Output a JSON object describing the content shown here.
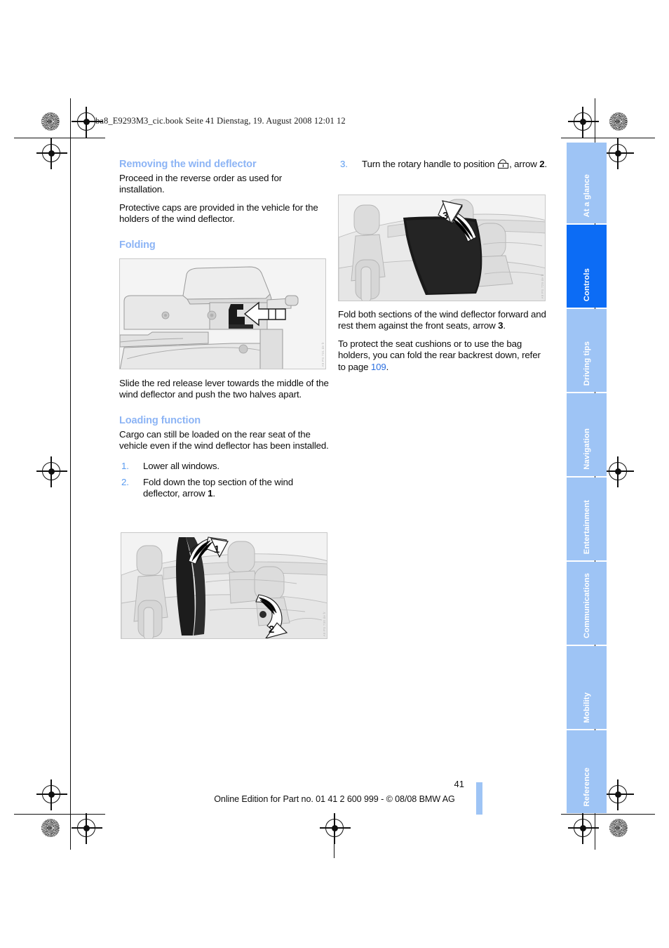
{
  "scan_header": "ba8_E9293M3_cic.book  Seite 41  Dienstag, 19. August 2008  12:01 12",
  "left_column": {
    "heading_1": "Removing the wind deflector",
    "para_1": "Proceed in the reverse order as used for installation.",
    "para_2": "Protective caps are provided in the vehicle for the holders of the wind deflector.",
    "heading_2": "Folding",
    "figure_1_code": "A9 PS 731 de fr",
    "para_3": "Slide the red release lever towards the middle of the wind deflector and push the two halves apart.",
    "heading_3": "Loading function",
    "para_4": "Cargo can still be loaded on the rear seat of the vehicle even if the wind deflector has been installed.",
    "steps": [
      {
        "num": "1.",
        "text": "Lower all windows."
      },
      {
        "num": "2.",
        "text_before": "Fold down the top section of the wind deflector, arrow ",
        "bold": "1",
        "text_after": "."
      }
    ],
    "figure_3_code": "A9 PS 730 de fr"
  },
  "right_column": {
    "step_3": {
      "num": "3.",
      "text_before": "Turn the rotary handle to position ",
      "icon": "open-padlock-icon",
      "text_middle": ", arrow ",
      "bold": "2",
      "text_after": "."
    },
    "figure_2_code": "A9 PS 729 de fr",
    "para_1_before": "Fold both sections of the wind deflector forward and rest them against the front seats, arrow ",
    "para_1_bold": "3",
    "para_1_after": ".",
    "para_2_before": "To protect the seat cushions or to use the bag holders, you can fold the rear backrest down, refer to page ",
    "para_2_link": "109",
    "para_2_after": "."
  },
  "tabs": [
    {
      "label": "At a glance",
      "active": false
    },
    {
      "label": "Controls",
      "active": true
    },
    {
      "label": "Driving tips",
      "active": false
    },
    {
      "label": "Navigation",
      "active": false
    },
    {
      "label": "Entertainment",
      "active": false
    },
    {
      "label": "Communications",
      "active": false
    },
    {
      "label": "Mobility",
      "active": false
    },
    {
      "label": "Reference",
      "active": false
    }
  ],
  "footer": {
    "page_number": "41",
    "text": "Online Edition for Part no. 01 41 2 600 999 - © 08/08 BMW AG"
  },
  "colors": {
    "heading_blue": "#8cb4f5",
    "tab_inactive": "#9ec4f5",
    "tab_active": "#0c6cf5",
    "link_blue": "#2b6fe0",
    "step_number_blue": "#5a9bf0"
  }
}
